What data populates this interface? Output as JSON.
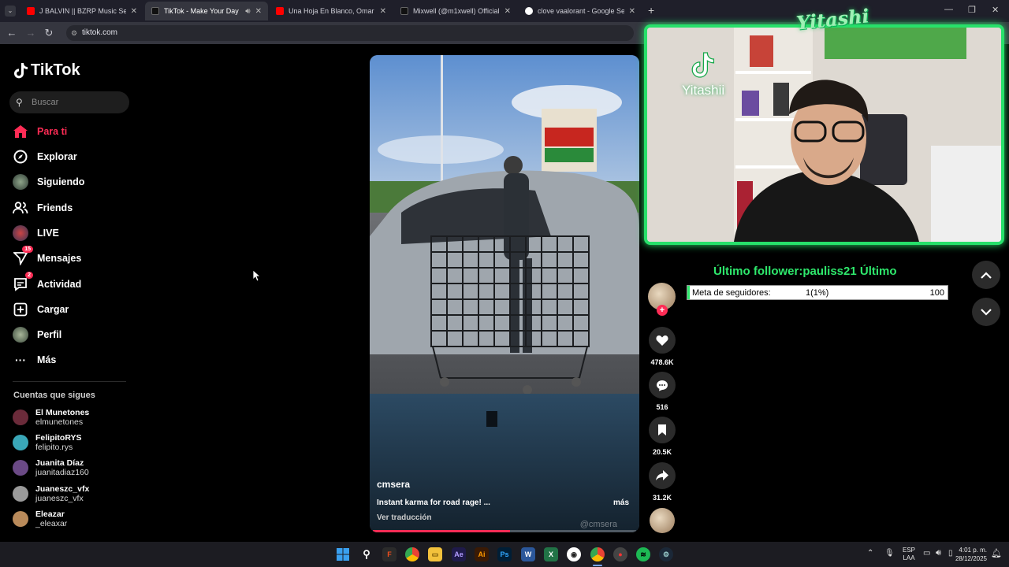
{
  "browser": {
    "tabs": [
      {
        "title": "J BALVIN || BZRP Music Sessions",
        "favicon_color": "#ff0000",
        "active": false
      },
      {
        "title": "TikTok - Make Your Day",
        "favicon_color": "#111111",
        "active": true
      },
      {
        "title": "Una Hoja En Blanco, Omar Geles",
        "favicon_color": "#ff0000",
        "active": false
      },
      {
        "title": "Mixwell (@m1xwell) Official | TikTok",
        "favicon_color": "#111111",
        "active": false
      },
      {
        "title": "clove vaalorant - Google Search",
        "favicon_color": "#4285f4",
        "active": false
      }
    ],
    "url": "tiktok.com"
  },
  "tiktok": {
    "logo": "TikTok",
    "search_placeholder": "Buscar",
    "nav": [
      {
        "label": "Para ti",
        "icon": "home-icon",
        "active": true,
        "badge": ""
      },
      {
        "label": "Explorar",
        "icon": "compass-icon",
        "active": false,
        "badge": ""
      },
      {
        "label": "Siguiendo",
        "icon": "avatar-icon",
        "active": false,
        "badge": ""
      },
      {
        "label": "Friends",
        "icon": "friends-icon",
        "active": false,
        "badge": ""
      },
      {
        "label": "LIVE",
        "icon": "live-icon",
        "active": false,
        "badge": ""
      },
      {
        "label": "Mensajes",
        "icon": "send-icon",
        "active": false,
        "badge": "15"
      },
      {
        "label": "Actividad",
        "icon": "activity-icon",
        "active": false,
        "badge": "2"
      },
      {
        "label": "Cargar",
        "icon": "upload-icon",
        "active": false,
        "badge": ""
      },
      {
        "label": "Perfil",
        "icon": "profile-icon",
        "active": false,
        "badge": ""
      },
      {
        "label": "Más",
        "icon": "more-icon",
        "active": false,
        "badge": ""
      }
    ],
    "following_heading": "Cuentas que sigues",
    "following": [
      {
        "name": "El Munetones",
        "handle": "elmunetones",
        "color": "#6b2b3a"
      },
      {
        "name": "FelipitoRYS",
        "handle": "felipito.rys",
        "color": "#3aa7b8"
      },
      {
        "name": "Juanita Díaz",
        "handle": "juanitadiaz160",
        "color": "#6b4a86"
      },
      {
        "name": "Juaneszc_vfx",
        "handle": "juaneszc_vfx",
        "color": "#9a9a9a"
      },
      {
        "name": "Eleazar",
        "handle": "_eleaxar",
        "color": "#b98a5a"
      }
    ],
    "video": {
      "author": "cmsera",
      "caption": "Instant karma for road rage!  ...",
      "more": "más",
      "translate": "Ver traducción",
      "watermark": "@cmsera",
      "progress": 0.52
    },
    "actions": {
      "likes": "478.6K",
      "comments": "516",
      "saves": "20.5K",
      "shares": "31.2K"
    }
  },
  "overlay": {
    "brand": "Yitashi",
    "cam_handle": "Yitashii",
    "ticker": "Último follower:pauliss21    Último",
    "goal": {
      "label": "Meta de seguidores:",
      "value": "1(1%)",
      "max": "100",
      "percent": 1
    }
  },
  "taskbar": {
    "lang": "ESP",
    "region": "LAA",
    "time": "4:01 p. m.",
    "date": "28/12/2025"
  }
}
